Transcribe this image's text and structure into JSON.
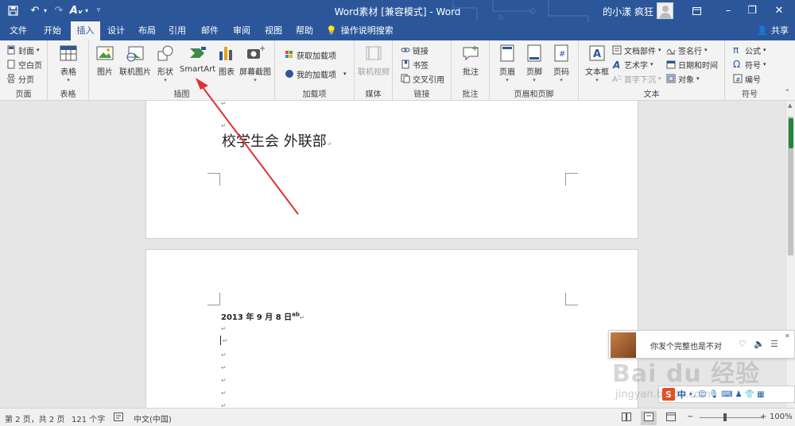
{
  "titlebar": {
    "title": "Word素材 [兼容模式] - Word",
    "user": "的小漾 疯狂",
    "quick_access": {
      "save_icon": "save-icon",
      "undo_icon": "undo-icon",
      "redo_icon": "redo-icon",
      "format_icon": "format-painter-icon",
      "customize_icon": "chevron-down-icon"
    },
    "window_controls": {
      "ribbon_options": "ribbon-display-icon",
      "minimize": "–",
      "restore": "❐",
      "close": "✕"
    }
  },
  "tabs": {
    "items": [
      "文件",
      "开始",
      "插入",
      "设计",
      "布局",
      "引用",
      "邮件",
      "审阅",
      "视图",
      "帮助"
    ],
    "active": "插入",
    "tell_me": "操作说明搜索",
    "share": "共享"
  },
  "ribbon": {
    "groups": {
      "page": {
        "label": "页面",
        "cover": "封面",
        "blank": "空白页",
        "break": "分页"
      },
      "table": {
        "label": "表格",
        "table": "表格"
      },
      "illustrations": {
        "label": "插图",
        "picture": "图片",
        "online_picture": "联机图片",
        "shapes": "形状",
        "smartart": "SmartArt",
        "chart": "图表",
        "screenshot": "屏幕截图"
      },
      "addins": {
        "label": "加载项",
        "get_addins": "获取加载项",
        "my_addins": "我的加载项"
      },
      "media": {
        "label": "媒体",
        "online_video": "联机视频"
      },
      "links": {
        "label": "链接",
        "link": "链接",
        "bookmark": "书签",
        "cross_ref": "交叉引用"
      },
      "comments": {
        "label": "批注",
        "comment": "批注"
      },
      "header_footer": {
        "label": "页眉和页脚",
        "header": "页眉",
        "footer": "页脚",
        "page_number": "页码"
      },
      "text": {
        "label": "文本",
        "textbox": "文本框",
        "quick_parts": "文档部件",
        "wordart": "艺术字",
        "dropcap": "首字下沉",
        "signature": "签名行",
        "datetime": "日期和时间",
        "object": "对象"
      },
      "symbols": {
        "label": "符号",
        "equation": "公式",
        "symbol": "符号",
        "number": "编号"
      }
    }
  },
  "document": {
    "page1_text": "校学生会  外联部",
    "page2_date": "2013 年 9 月 8 日",
    "page2_superscript": "ab",
    "para_mark": "↵"
  },
  "statusbar": {
    "page": "第 2 页，共 2 页",
    "words": "121 个字",
    "language": "中文(中国)",
    "zoom": "100%",
    "zoom_minus": "−",
    "zoom_plus": "+"
  },
  "popup": {
    "song": "你发个完整也是不对",
    "like_icon": "heart-icon",
    "volume_icon": "volume-icon",
    "list_icon": "list-icon",
    "close": "✕"
  },
  "ime": {
    "logo": "S",
    "mode": "中",
    "punct": "•,"
  },
  "watermark": {
    "main": "Bai du 经验",
    "sub": "jingyan.baidu.com"
  },
  "colors": {
    "accent": "#2b579a",
    "annotation": "#e03030"
  }
}
